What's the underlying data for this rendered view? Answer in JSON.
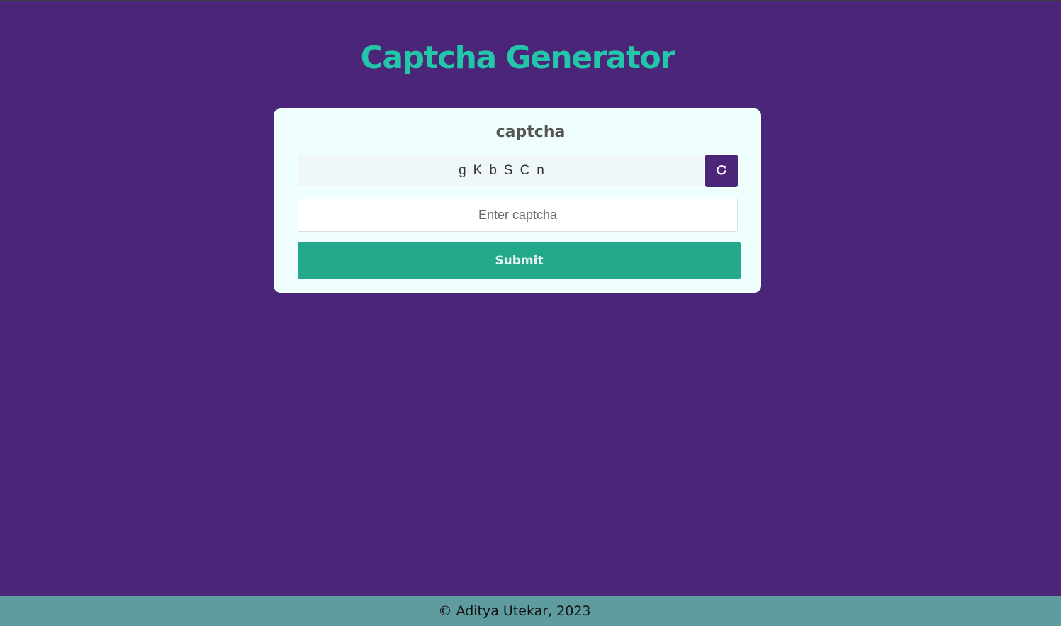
{
  "page": {
    "title": "Captcha Generator"
  },
  "card": {
    "heading": "captcha",
    "captcha_text": "gKbSCn",
    "refresh_icon": "refresh-icon",
    "input": {
      "value": "",
      "placeholder": "Enter captcha"
    },
    "submit_label": "Submit"
  },
  "footer": {
    "text": "© Aditya Utekar, 2023"
  },
  "colors": {
    "background": "#4b2578",
    "title": "#22c7a9",
    "card": "#effffe",
    "submit": "#22a98c",
    "footer": "#5e9c9f"
  }
}
